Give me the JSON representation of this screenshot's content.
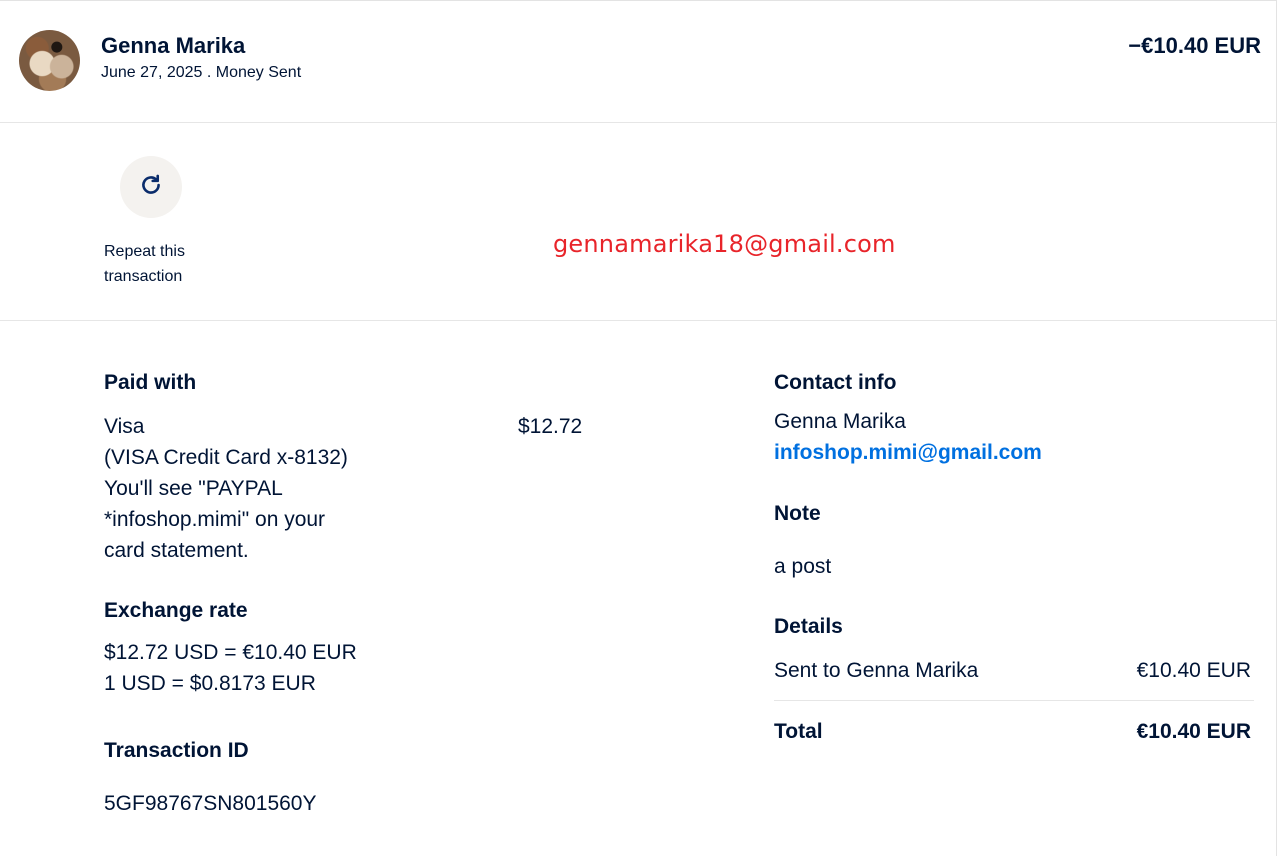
{
  "header": {
    "name": "Genna Marika",
    "date": "June 27, 2025",
    "separator": " . ",
    "type": "Money Sent",
    "amount": "−€10.40 EUR"
  },
  "repeat": {
    "icon": "refresh-icon",
    "line1": "Repeat this",
    "line2": "transaction"
  },
  "overlay_email": "gennamarika18@gmail.com",
  "paid_with": {
    "heading": "Paid with",
    "method": "Visa",
    "card": "(VISA Credit Card x-8132)",
    "statement_line1": "You'll see \"PAYPAL",
    "statement_line2": "*infoshop.mimi\" on your",
    "statement_line3": "card statement.",
    "amount": "$12.72"
  },
  "exchange": {
    "heading": "Exchange rate",
    "line1": "$12.72 USD = €10.40 EUR",
    "line2": "1 USD = $0.8173 EUR"
  },
  "transaction": {
    "heading": "Transaction ID",
    "id": "5GF98767SN801560Y"
  },
  "contact": {
    "heading": "Contact info",
    "name": "Genna Marika",
    "email": "infoshop.mimi@gmail.com"
  },
  "note": {
    "heading": "Note",
    "text": "a post"
  },
  "details": {
    "heading": "Details",
    "sent_label": "Sent to Genna Marika",
    "sent_amount": "€10.40 EUR",
    "total_label": "Total",
    "total_amount": "€10.40 EUR"
  },
  "colors": {
    "text": "#001435",
    "link": "#0070e0",
    "overlay": "#e8242a"
  }
}
